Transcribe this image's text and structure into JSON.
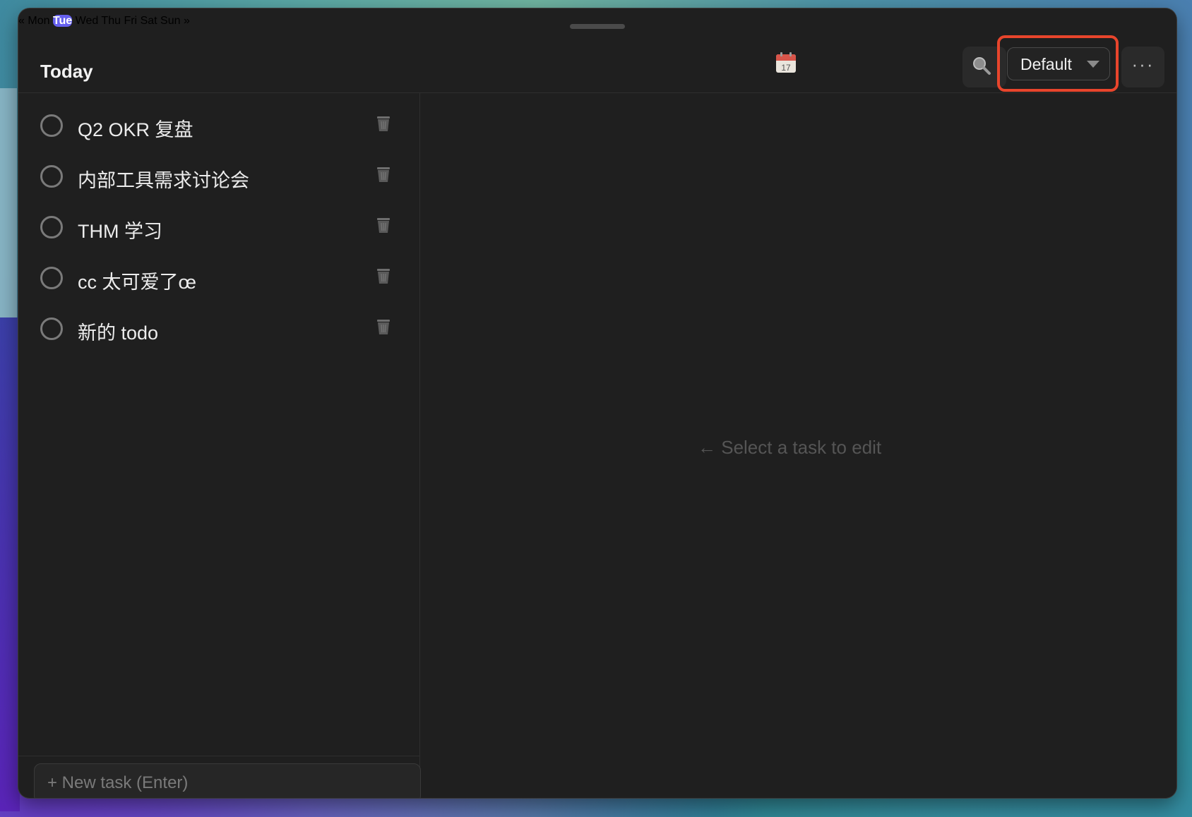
{
  "window": {
    "title": "Today"
  },
  "week_nav": {
    "prev_label": "«",
    "next_label": "»",
    "days": [
      "Mon",
      "Tue",
      "Wed",
      "Thu",
      "Fri",
      "Sat",
      "Sun"
    ],
    "active_day": "Tue",
    "calendar_icon": "calendar-icon",
    "calendar_date": "17"
  },
  "toolbar": {
    "search_icon": "search-icon",
    "list_select_value": "Default",
    "more_label": "···"
  },
  "tasks": [
    {
      "title": "Q2 OKR 复盘",
      "done": false
    },
    {
      "title": "内部工具需求讨论会",
      "done": false
    },
    {
      "title": "THM 学习",
      "done": false
    },
    {
      "title": "cc 太可爱了œ",
      "done": false
    },
    {
      "title": "新的 todo",
      "done": false
    }
  ],
  "new_task": {
    "placeholder": "+ New task (Enter)"
  },
  "editor": {
    "empty_hint": "← Select a task to edit"
  },
  "colors": {
    "accent": "#6660ee",
    "highlight": "#e8452c",
    "window_bg": "#1f1f1f"
  }
}
